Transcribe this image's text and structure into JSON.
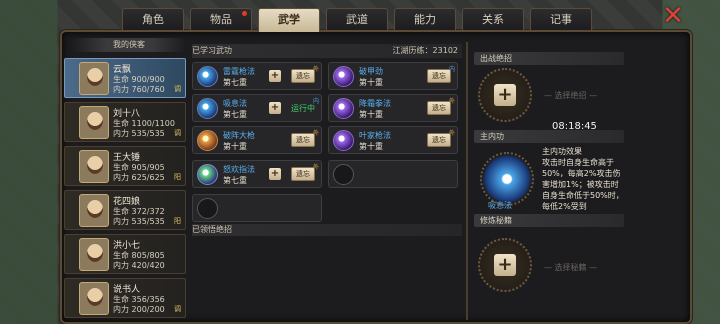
{
  "tabs": [
    {
      "label": "角色",
      "active": false,
      "dot": false
    },
    {
      "label": "物品",
      "active": false,
      "dot": true
    },
    {
      "label": "武学",
      "active": true,
      "dot": false
    },
    {
      "label": "武道",
      "active": false,
      "dot": false
    },
    {
      "label": "能力",
      "active": false,
      "dot": false
    },
    {
      "label": "关系",
      "active": false,
      "dot": false
    },
    {
      "label": "记事",
      "active": false,
      "dot": false
    }
  ],
  "close_icon": "close-x-icon",
  "heroes_header": "我的侠客",
  "heroes": [
    {
      "name": "云飘",
      "hp": "生命 900/900",
      "mp": "内力 760/760",
      "tag": "调",
      "active": true
    },
    {
      "name": "刘十八",
      "hp": "生命 1100/1100",
      "mp": "内力 535/535",
      "tag": "调",
      "active": false
    },
    {
      "name": "王大锤",
      "hp": "生命 905/905",
      "mp": "内力 625/625",
      "tag": "阳",
      "active": false
    },
    {
      "name": "花四娘",
      "hp": "生命 372/372",
      "mp": "内力 535/535",
      "tag": "阳",
      "active": false
    },
    {
      "name": "洪小七",
      "hp": "生命 805/805",
      "mp": "内力 420/420",
      "tag": "",
      "active": false
    },
    {
      "name": "说书人",
      "hp": "生命 356/356",
      "mp": "内力 200/200",
      "tag": "调",
      "active": false
    }
  ],
  "learned": {
    "title": "已学习武功",
    "exp": "江湖历练：23102"
  },
  "skills": [
    {
      "name": "雷霆枪法",
      "level": "第七重",
      "action": "plus-forget",
      "corner": "外",
      "icon": "blue"
    },
    {
      "name": "破甲劲",
      "level": "第十重",
      "action": "forget",
      "corner": "内",
      "icon": "purple"
    },
    {
      "name": "吸息法",
      "level": "第七重",
      "action": "plus-running",
      "corner": "内",
      "icon": "blue"
    },
    {
      "name": "降霜拳法",
      "level": "第十重",
      "action": "forget",
      "corner": "外",
      "icon": "purple"
    },
    {
      "name": "破阵大枪",
      "level": "第十重",
      "action": "forget",
      "corner": "外",
      "icon": "fire"
    },
    {
      "name": "叶家枪法",
      "level": "第十重",
      "action": "forget",
      "corner": "外",
      "icon": "purple"
    },
    {
      "name": "怒欢指法",
      "level": "第七重",
      "action": "plus-forget",
      "corner": "外",
      "icon": "green"
    }
  ],
  "forget_label": "遗忘",
  "running_label": "运行中",
  "plus_label": "+",
  "comprehended_title": "已领悟绝招",
  "right": {
    "combat_title": "出战绝招",
    "combat_placeholder": "选择绝招",
    "timer": "08:18:45",
    "inner_title": "主内功",
    "inner_name": "吸息法",
    "effect_title": "主内功效果",
    "effect_text": "攻击时自身生命高于50%，每高2%攻击伤害增加1%；被攻击时自身生命低于50%时，每低2%受到",
    "secret_title": "修炼秘籍",
    "secret_placeholder": "选择秘籍"
  }
}
